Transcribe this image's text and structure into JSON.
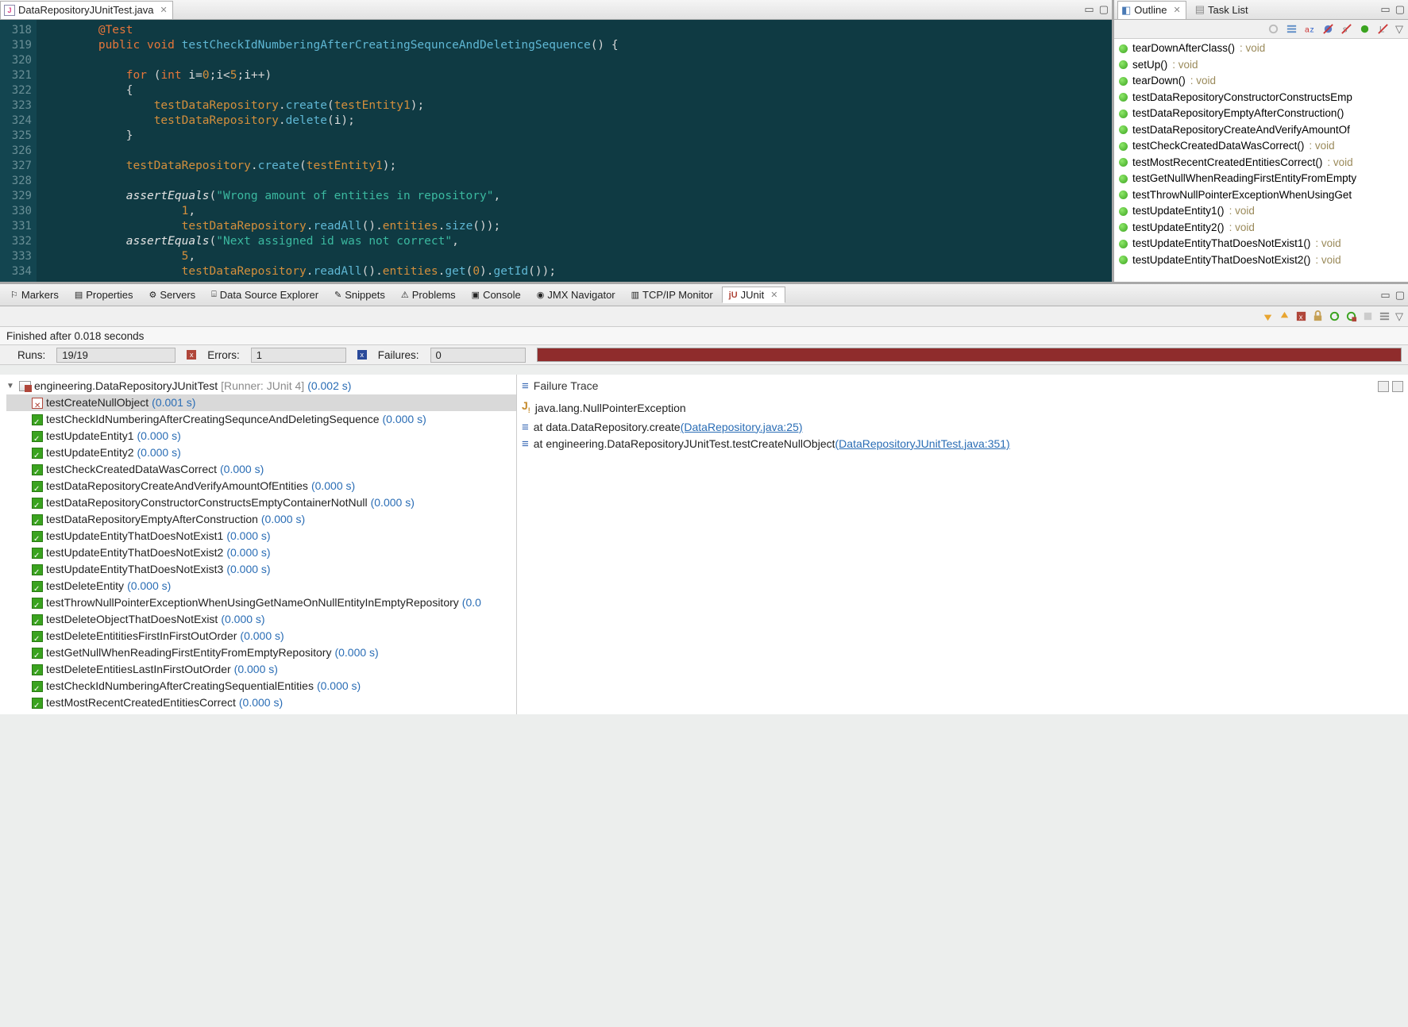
{
  "editor": {
    "tab_title": "DataRepositoryJUnitTest.java",
    "line_start": 318,
    "lines": [
      {
        "n": 318,
        "html": "        <span class='k-orange'>@Test</span>"
      },
      {
        "n": 319,
        "html": "        <span class='k-orange'>public</span> <span class='k-orange'>void</span> <span class='k-blue'>testCheckIdNumberingAfterCreatingSequnceAndDeletingSequence</span><span class='k-paren'>()</span> <span class='k-paren'>{</span>"
      },
      {
        "n": 320,
        "html": ""
      },
      {
        "n": 321,
        "html": "            <span class='k-orange'>for</span> <span class='k-paren'>(</span><span class='k-orange'>int</span> <span class='k-white'>i</span>=<span class='k-num'>0</span>;<span class='k-white'>i</span>&lt;<span class='k-num'>5</span>;<span class='k-white'>i</span>++<span class='k-paren'>)</span>"
      },
      {
        "n": 322,
        "html": "            <span class='k-paren'>{</span>"
      },
      {
        "n": 323,
        "html": "                <span class='k-field'>testDataRepository</span>.<span class='k-blue'>create</span><span class='k-paren'>(</span><span class='k-field'>testEntity1</span><span class='k-paren'>)</span>;"
      },
      {
        "n": 324,
        "html": "                <span class='k-field'>testDataRepository</span>.<span class='k-blue'>delete</span><span class='k-paren'>(</span><span class='k-white'>i</span><span class='k-paren'>)</span>;"
      },
      {
        "n": 325,
        "html": "            <span class='k-paren'>}</span>"
      },
      {
        "n": 326,
        "html": ""
      },
      {
        "n": 327,
        "html": "            <span class='k-field'>testDataRepository</span>.<span class='k-blue'>create</span><span class='k-paren'>(</span><span class='k-field'>testEntity1</span><span class='k-paren'>)</span>;"
      },
      {
        "n": 328,
        "html": ""
      },
      {
        "n": 329,
        "html": "            <span class='k-italic'>assertEquals</span><span class='k-paren'>(</span><span class='k-teal'>\"Wrong amount of entities in repository\"</span>,"
      },
      {
        "n": 330,
        "html": "                    <span class='k-num'>1</span>,"
      },
      {
        "n": 331,
        "html": "                    <span class='k-field'>testDataRepository</span>.<span class='k-blue'>readAll</span><span class='k-paren'>()</span>.<span class='k-field'>entities</span>.<span class='k-blue'>size</span><span class='k-paren'>()</span><span class='k-paren'>)</span>;"
      },
      {
        "n": 332,
        "html": "            <span class='k-italic'>assertEquals</span><span class='k-paren'>(</span><span class='k-teal'>\"Next assigned id was not correct\"</span>,"
      },
      {
        "n": 333,
        "html": "                    <span class='k-num'>5</span>,"
      },
      {
        "n": 334,
        "html": "                    <span class='k-field'>testDataRepository</span>.<span class='k-blue'>readAll</span><span class='k-paren'>()</span>.<span class='k-field'>entities</span>.<span class='k-blue'>get</span><span class='k-paren'>(</span><span class='k-num'>0</span><span class='k-paren'>)</span>.<span class='k-blue'>getId</span><span class='k-paren'>()</span><span class='k-paren'>)</span>;"
      }
    ]
  },
  "outline": {
    "tab1": "Outline",
    "tab2": "Task List",
    "items": [
      {
        "name": "tearDownAfterClass()",
        "ret": "void"
      },
      {
        "name": "setUp()",
        "ret": "void"
      },
      {
        "name": "tearDown()",
        "ret": "void"
      },
      {
        "name": "testDataRepositoryConstructorConstructsEmp",
        "ret": ""
      },
      {
        "name": "testDataRepositoryEmptyAfterConstruction()",
        "ret": ""
      },
      {
        "name": "testDataRepositoryCreateAndVerifyAmountOf",
        "ret": ""
      },
      {
        "name": "testCheckCreatedDataWasCorrect()",
        "ret": "void"
      },
      {
        "name": "testMostRecentCreatedEntitiesCorrect()",
        "ret": "void"
      },
      {
        "name": "testGetNullWhenReadingFirstEntityFromEmpty",
        "ret": ""
      },
      {
        "name": "testThrowNullPointerExceptionWhenUsingGet",
        "ret": ""
      },
      {
        "name": "testUpdateEntity1()",
        "ret": "void"
      },
      {
        "name": "testUpdateEntity2()",
        "ret": "void"
      },
      {
        "name": "testUpdateEntityThatDoesNotExist1()",
        "ret": "void"
      },
      {
        "name": "testUpdateEntityThatDoesNotExist2()",
        "ret": "void"
      }
    ]
  },
  "views": {
    "tabs": [
      "Markers",
      "Properties",
      "Servers",
      "Data Source Explorer",
      "Snippets",
      "Problems",
      "Console",
      "JMX Navigator",
      "TCP/IP Monitor",
      "JUnit"
    ],
    "active": "JUnit"
  },
  "junit": {
    "status": "Finished after 0.018 seconds",
    "runs_label": "Runs:",
    "runs": "19/19",
    "errors_label": "Errors:",
    "errors": "1",
    "failures_label": "Failures:",
    "failures": "0",
    "suite": "engineering.DataRepositoryJUnitTest",
    "runner": "[Runner: JUnit 4]",
    "suite_time": "(0.002 s)",
    "tests": [
      {
        "name": "testCreateNullObject",
        "time": "(0.001 s)",
        "status": "fail",
        "selected": true
      },
      {
        "name": "testCheckIdNumberingAfterCreatingSequnceAndDeletingSequence",
        "time": "(0.000 s)",
        "status": "pass"
      },
      {
        "name": "testUpdateEntity1",
        "time": "(0.000 s)",
        "status": "pass"
      },
      {
        "name": "testUpdateEntity2",
        "time": "(0.000 s)",
        "status": "pass"
      },
      {
        "name": "testCheckCreatedDataWasCorrect",
        "time": "(0.000 s)",
        "status": "pass"
      },
      {
        "name": "testDataRepositoryCreateAndVerifyAmountOfEntities",
        "time": "(0.000 s)",
        "status": "pass"
      },
      {
        "name": "testDataRepositoryConstructorConstructsEmptyContainerNotNull",
        "time": "(0.000 s)",
        "status": "pass"
      },
      {
        "name": "testDataRepositoryEmptyAfterConstruction",
        "time": "(0.000 s)",
        "status": "pass"
      },
      {
        "name": "testUpdateEntityThatDoesNotExist1",
        "time": "(0.000 s)",
        "status": "pass"
      },
      {
        "name": "testUpdateEntityThatDoesNotExist2",
        "time": "(0.000 s)",
        "status": "pass"
      },
      {
        "name": "testUpdateEntityThatDoesNotExist3",
        "time": "(0.000 s)",
        "status": "pass"
      },
      {
        "name": "testDeleteEntity",
        "time": "(0.000 s)",
        "status": "pass"
      },
      {
        "name": "testThrowNullPointerExceptionWhenUsingGetNameOnNullEntityInEmptyRepository",
        "time": "(0.0",
        "status": "pass"
      },
      {
        "name": "testDeleteObjectThatDoesNotExist",
        "time": "(0.000 s)",
        "status": "pass"
      },
      {
        "name": "testDeleteEntititiesFirstInFirstOutOrder",
        "time": "(0.000 s)",
        "status": "pass"
      },
      {
        "name": "testGetNullWhenReadingFirstEntityFromEmptyRepository",
        "time": "(0.000 s)",
        "status": "pass"
      },
      {
        "name": "testDeleteEntitiesLastInFirstOutOrder",
        "time": "(0.000 s)",
        "status": "pass"
      },
      {
        "name": "testCheckIdNumberingAfterCreatingSequentialEntities",
        "time": "(0.000 s)",
        "status": "pass"
      },
      {
        "name": "testMostRecentCreatedEntitiesCorrect",
        "time": "(0.000 s)",
        "status": "pass"
      }
    ],
    "trace_title": "Failure Trace",
    "trace": [
      {
        "prefix": "J",
        "text": "java.lang.NullPointerException",
        "link": ""
      },
      {
        "prefix": "≡",
        "text": "at data.DataRepository.create",
        "link": "(DataRepository.java:25)"
      },
      {
        "prefix": "≡",
        "text": "at engineering.DataRepositoryJUnitTest.testCreateNullObject",
        "link": "(DataRepositoryJUnitTest.java:351)"
      }
    ]
  }
}
